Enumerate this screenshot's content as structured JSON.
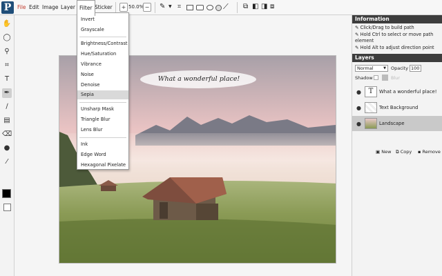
{
  "app": {
    "logo_letter": "P"
  },
  "menubar": {
    "items": [
      "File",
      "Edit",
      "Image",
      "Layer",
      "Filter",
      "Sticker"
    ],
    "active": "Filter"
  },
  "toolbar": {
    "zoom_in": "+",
    "zoom_level": "50.0%",
    "zoom_out": "−"
  },
  "filter_menu": {
    "items": [
      "Invert",
      "Grayscale",
      "Brightness/Contrast",
      "Hue/Saturation",
      "Vibrance",
      "Noise",
      "Denoise",
      "Sepia",
      "Unsharp Mask",
      "Triangle Blur",
      "Lens Blur",
      "Ink",
      "Edge Word",
      "Hexagonal Pixelate"
    ],
    "highlighted": "Sepia"
  },
  "canvas": {
    "caption": "What a wonderful place!"
  },
  "info_panel": {
    "title": "Information",
    "lines": [
      "Click/Drag to build path",
      "Hold Ctrl to select or move path element",
      "Hold Alt to adjust direction point"
    ]
  },
  "layers_panel": {
    "title": "Layers",
    "blend_mode": "Normal",
    "opacity_label": "Opacity",
    "opacity_value": "100",
    "shadow_label": "Shadow",
    "blur_label": "Blur",
    "layers": [
      {
        "name": "What a wonderful place!",
        "type": "text"
      },
      {
        "name": "Text Background",
        "type": "shape"
      },
      {
        "name": "Landscape",
        "type": "image",
        "selected": true
      }
    ],
    "buttons": {
      "new": "New",
      "copy": "Copy",
      "remove": "Remove"
    }
  },
  "colors": {
    "accent": "#1f4e79",
    "panel_header": "#3d3d3d",
    "foreground": "#000000",
    "background": "#ffffff"
  }
}
